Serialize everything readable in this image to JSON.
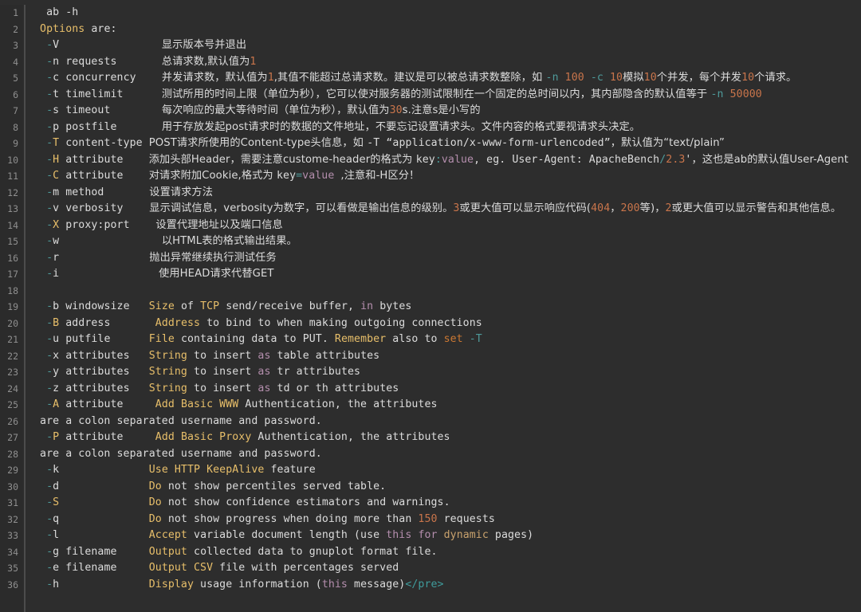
{
  "editor": {
    "language": "shell-help-output",
    "theme": "dark",
    "background_color": "#2d2d2d",
    "gutter_color": "#2b2b2b",
    "default_text_color": "#dcdcdc",
    "first_line_number": 1,
    "last_line_number": 36,
    "total_lines": 36
  },
  "palette": {
    "keyword_yellow": "#e8bf6a",
    "number_orange": "#c9754b",
    "purple": "#b48ead",
    "teal": "#4e9a9a",
    "salmon": "#cc7832",
    "tan": "#c9a26d",
    "line_number": "#8f8f8f"
  },
  "lines": [
    {
      "n": "1",
      "tokens": [
        {
          "t": "  ab -h",
          "c": "def"
        }
      ]
    },
    {
      "n": "2",
      "tokens": [
        {
          "t": " ",
          "c": "def"
        },
        {
          "t": "Options",
          "c": "key"
        },
        {
          "t": " are:",
          "c": "def"
        }
      ]
    },
    {
      "n": "3",
      "tokens": [
        {
          "t": "  ",
          "c": "def"
        },
        {
          "t": "-",
          "c": "teal"
        },
        {
          "t": "V                ",
          "c": "def"
        },
        {
          "t": "显示版本号并退出",
          "c": "cn"
        }
      ]
    },
    {
      "n": "4",
      "tokens": [
        {
          "t": "  ",
          "c": "def"
        },
        {
          "t": "-",
          "c": "teal"
        },
        {
          "t": "n requests       ",
          "c": "def"
        },
        {
          "t": "总请求数,默认值为",
          "c": "cn"
        },
        {
          "t": "1",
          "c": "num"
        }
      ]
    },
    {
      "n": "5",
      "tokens": [
        {
          "t": "  ",
          "c": "def"
        },
        {
          "t": "-",
          "c": "teal"
        },
        {
          "t": "c concurrency    ",
          "c": "def"
        },
        {
          "t": "并发请求数，默认值为",
          "c": "cn"
        },
        {
          "t": "1",
          "c": "num"
        },
        {
          "t": ",其值不能超过总请求数。建议是可以被总请求数整除，如 ",
          "c": "cn"
        },
        {
          "t": "-n",
          "c": "teal"
        },
        {
          "t": " ",
          "c": "def"
        },
        {
          "t": "100",
          "c": "num"
        },
        {
          "t": " ",
          "c": "def"
        },
        {
          "t": "-c",
          "c": "teal"
        },
        {
          "t": " ",
          "c": "def"
        },
        {
          "t": "10",
          "c": "num"
        },
        {
          "t": "模拟",
          "c": "cn"
        },
        {
          "t": "10",
          "c": "num"
        },
        {
          "t": "个并发，每个并发",
          "c": "cn"
        },
        {
          "t": "10",
          "c": "num"
        },
        {
          "t": "个请求。",
          "c": "cn"
        }
      ]
    },
    {
      "n": "6",
      "tokens": [
        {
          "t": "  ",
          "c": "def"
        },
        {
          "t": "-",
          "c": "teal"
        },
        {
          "t": "t timelimit      ",
          "c": "def"
        },
        {
          "t": "测试所用的时间上限（单位为秒），它可以使对服务器的测试限制在一个固定的总时间以内，其内部隐含的默认值等于 ",
          "c": "cn"
        },
        {
          "t": "-n",
          "c": "teal"
        },
        {
          "t": " ",
          "c": "def"
        },
        {
          "t": "50000",
          "c": "num"
        }
      ]
    },
    {
      "n": "7",
      "tokens": [
        {
          "t": "  ",
          "c": "def"
        },
        {
          "t": "-",
          "c": "teal"
        },
        {
          "t": "s timeout        ",
          "c": "def"
        },
        {
          "t": "每次响应的最大等待时间（单位为秒），默认值为",
          "c": "cn"
        },
        {
          "t": "30",
          "c": "num"
        },
        {
          "t": "s.注意s是小写的",
          "c": "cn"
        }
      ]
    },
    {
      "n": "8",
      "tokens": [
        {
          "t": "  ",
          "c": "def"
        },
        {
          "t": "-",
          "c": "teal"
        },
        {
          "t": "p postfile       ",
          "c": "def"
        },
        {
          "t": "用于存放发起post请求时的数据的文件地址，不要忘记设置请求头。文件内容的格式要视请求头决定。",
          "c": "cn"
        }
      ]
    },
    {
      "n": "9",
      "tokens": [
        {
          "t": "  ",
          "c": "def"
        },
        {
          "t": "-",
          "c": "teal"
        },
        {
          "t": "T",
          "c": "key"
        },
        {
          "t": " content-type ",
          "c": "def"
        },
        {
          "t": "POST请求所使用的Content-type头信息，如 ",
          "c": "cn"
        },
        {
          "t": "-T",
          "c": "def"
        },
        {
          "t": " “application/x-www-form-urlencoded”",
          "c": "def"
        },
        {
          "t": "，默认值为“text/plain”",
          "c": "cn"
        }
      ]
    },
    {
      "n": "10",
      "tokens": [
        {
          "t": "  ",
          "c": "def"
        },
        {
          "t": "-",
          "c": "teal"
        },
        {
          "t": "H",
          "c": "key"
        },
        {
          "t": " attribute    ",
          "c": "def"
        },
        {
          "t": "添加头部Header，需要注意custome-header的格式为 ",
          "c": "cn"
        },
        {
          "t": "key",
          "c": "def"
        },
        {
          "t": ":",
          "c": "teal"
        },
        {
          "t": "value",
          "c": "purple"
        },
        {
          "t": ", eg. User-Agent: ApacheBench",
          "c": "def"
        },
        {
          "t": "/",
          "c": "teal"
        },
        {
          "t": "2.3",
          "c": "num"
        },
        {
          "t": "'",
          "c": "def"
        },
        {
          "t": "，这也是ab的默认值User-Agent",
          "c": "cn"
        }
      ]
    },
    {
      "n": "11",
      "tokens": [
        {
          "t": "  ",
          "c": "def"
        },
        {
          "t": "-",
          "c": "teal"
        },
        {
          "t": "C",
          "c": "key"
        },
        {
          "t": " attribute    ",
          "c": "def"
        },
        {
          "t": "对请求附加Cookie,格式为 ",
          "c": "cn"
        },
        {
          "t": "key",
          "c": "def"
        },
        {
          "t": "=",
          "c": "teal"
        },
        {
          "t": "value",
          "c": "purple"
        },
        {
          "t": " ",
          "c": "def"
        },
        {
          "t": ",注意和-H区分！",
          "c": "cn"
        }
      ]
    },
    {
      "n": "12",
      "tokens": [
        {
          "t": "  ",
          "c": "def"
        },
        {
          "t": "-",
          "c": "teal"
        },
        {
          "t": "m method      ",
          "c": "def"
        },
        {
          "t": "  设置请求方法",
          "c": "cn"
        }
      ]
    },
    {
      "n": "13",
      "tokens": [
        {
          "t": "  ",
          "c": "def"
        },
        {
          "t": "-",
          "c": "teal"
        },
        {
          "t": "v verbosity   ",
          "c": "def"
        },
        {
          "t": "  显示调试信息，verbosity为数字，可以看做是输出信息的级别。",
          "c": "cn"
        },
        {
          "t": "3",
          "c": "num"
        },
        {
          "t": "或更大值可以显示响应代码(",
          "c": "cn"
        },
        {
          "t": "404",
          "c": "num"
        },
        {
          "t": "，",
          "c": "cn"
        },
        {
          "t": "200",
          "c": "num"
        },
        {
          "t": "等)，",
          "c": "cn"
        },
        {
          "t": "2",
          "c": "num"
        },
        {
          "t": "或更大值可以显示警告和其他信息。",
          "c": "cn"
        }
      ]
    },
    {
      "n": "14",
      "tokens": [
        {
          "t": "  ",
          "c": "def"
        },
        {
          "t": "-",
          "c": "teal"
        },
        {
          "t": "X",
          "c": "key"
        },
        {
          "t": " proxy:port   ",
          "c": "def"
        },
        {
          "t": "  设置代理地址以及端口信息",
          "c": "cn"
        }
      ]
    },
    {
      "n": "15",
      "tokens": [
        {
          "t": "  ",
          "c": "def"
        },
        {
          "t": "-",
          "c": "teal"
        },
        {
          "t": "w                ",
          "c": "def"
        },
        {
          "t": "以HTML表的格式输出结果。",
          "c": "cn"
        }
      ]
    },
    {
      "n": "16",
      "tokens": [
        {
          "t": "  ",
          "c": "def"
        },
        {
          "t": "-",
          "c": "teal"
        },
        {
          "t": "r             ",
          "c": "def"
        },
        {
          "t": "  抛出异常继续执行测试任务",
          "c": "cn"
        }
      ]
    },
    {
      "n": "17",
      "tokens": [
        {
          "t": "  ",
          "c": "def"
        },
        {
          "t": "-",
          "c": "teal"
        },
        {
          "t": "i               ",
          "c": "def"
        },
        {
          "t": " 使用HEAD请求代替GET",
          "c": "cn"
        }
      ]
    },
    {
      "n": "18",
      "tokens": [
        {
          "t": "",
          "c": "def"
        }
      ]
    },
    {
      "n": "19",
      "tokens": [
        {
          "t": "  ",
          "c": "def"
        },
        {
          "t": "-",
          "c": "teal"
        },
        {
          "t": "b windowsize   ",
          "c": "def"
        },
        {
          "t": "Size",
          "c": "key"
        },
        {
          "t": " of ",
          "c": "def"
        },
        {
          "t": "TCP",
          "c": "key"
        },
        {
          "t": " send/receive buffer, ",
          "c": "def"
        },
        {
          "t": "in",
          "c": "purple"
        },
        {
          "t": " bytes",
          "c": "def"
        }
      ]
    },
    {
      "n": "20",
      "tokens": [
        {
          "t": "  ",
          "c": "def"
        },
        {
          "t": "-",
          "c": "teal"
        },
        {
          "t": "B",
          "c": "key"
        },
        {
          "t": " address       ",
          "c": "def"
        },
        {
          "t": "Address",
          "c": "key"
        },
        {
          "t": " to bind to when making outgoing connections",
          "c": "def"
        }
      ]
    },
    {
      "n": "21",
      "tokens": [
        {
          "t": "  ",
          "c": "def"
        },
        {
          "t": "-",
          "c": "teal"
        },
        {
          "t": "u putfile      ",
          "c": "def"
        },
        {
          "t": "File",
          "c": "key"
        },
        {
          "t": " containing data to PUT. ",
          "c": "def"
        },
        {
          "t": "Remember",
          "c": "key"
        },
        {
          "t": " also to ",
          "c": "def"
        },
        {
          "t": "set",
          "c": "salmon"
        },
        {
          "t": " ",
          "c": "def"
        },
        {
          "t": "-T",
          "c": "teal"
        }
      ]
    },
    {
      "n": "22",
      "tokens": [
        {
          "t": "  ",
          "c": "def"
        },
        {
          "t": "-",
          "c": "teal"
        },
        {
          "t": "x attributes   ",
          "c": "def"
        },
        {
          "t": "String",
          "c": "key"
        },
        {
          "t": " to insert ",
          "c": "def"
        },
        {
          "t": "as",
          "c": "purple"
        },
        {
          "t": " table attributes",
          "c": "def"
        }
      ]
    },
    {
      "n": "23",
      "tokens": [
        {
          "t": "  ",
          "c": "def"
        },
        {
          "t": "-",
          "c": "teal"
        },
        {
          "t": "y attributes   ",
          "c": "def"
        },
        {
          "t": "String",
          "c": "key"
        },
        {
          "t": " to insert ",
          "c": "def"
        },
        {
          "t": "as",
          "c": "purple"
        },
        {
          "t": " tr attributes",
          "c": "def"
        }
      ]
    },
    {
      "n": "24",
      "tokens": [
        {
          "t": "  ",
          "c": "def"
        },
        {
          "t": "-",
          "c": "teal"
        },
        {
          "t": "z attributes   ",
          "c": "def"
        },
        {
          "t": "String",
          "c": "key"
        },
        {
          "t": " to insert ",
          "c": "def"
        },
        {
          "t": "as",
          "c": "purple"
        },
        {
          "t": " td or th attributes",
          "c": "def"
        }
      ]
    },
    {
      "n": "25",
      "tokens": [
        {
          "t": "  ",
          "c": "def"
        },
        {
          "t": "-",
          "c": "teal"
        },
        {
          "t": "A",
          "c": "key"
        },
        {
          "t": " attribute     ",
          "c": "def"
        },
        {
          "t": "Add Basic WWW",
          "c": "key"
        },
        {
          "t": " Authentication, the attributes",
          "c": "def"
        }
      ]
    },
    {
      "n": "26",
      "tokens": [
        {
          "t": " are a colon separated username and password.",
          "c": "def"
        }
      ]
    },
    {
      "n": "27",
      "tokens": [
        {
          "t": "  ",
          "c": "def"
        },
        {
          "t": "-",
          "c": "teal"
        },
        {
          "t": "P",
          "c": "key"
        },
        {
          "t": " attribute     ",
          "c": "def"
        },
        {
          "t": "Add Basic Proxy",
          "c": "key"
        },
        {
          "t": " Authentication, the attributes",
          "c": "def"
        }
      ]
    },
    {
      "n": "28",
      "tokens": [
        {
          "t": " are a colon separated username and password.",
          "c": "def"
        }
      ]
    },
    {
      "n": "29",
      "tokens": [
        {
          "t": "  ",
          "c": "def"
        },
        {
          "t": "-",
          "c": "teal"
        },
        {
          "t": "k              ",
          "c": "def"
        },
        {
          "t": "Use HTTP KeepAlive",
          "c": "key"
        },
        {
          "t": " feature",
          "c": "def"
        }
      ]
    },
    {
      "n": "30",
      "tokens": [
        {
          "t": "  ",
          "c": "def"
        },
        {
          "t": "-",
          "c": "teal"
        },
        {
          "t": "d              ",
          "c": "def"
        },
        {
          "t": "Do",
          "c": "key"
        },
        {
          "t": " not show percentiles served table.",
          "c": "def"
        }
      ]
    },
    {
      "n": "31",
      "tokens": [
        {
          "t": "  ",
          "c": "def"
        },
        {
          "t": "-",
          "c": "teal"
        },
        {
          "t": "S",
          "c": "key"
        },
        {
          "t": "              ",
          "c": "def"
        },
        {
          "t": "Do",
          "c": "key"
        },
        {
          "t": " not show confidence estimators and warnings.",
          "c": "def"
        }
      ]
    },
    {
      "n": "32",
      "tokens": [
        {
          "t": "  ",
          "c": "def"
        },
        {
          "t": "-",
          "c": "teal"
        },
        {
          "t": "q              ",
          "c": "def"
        },
        {
          "t": "Do",
          "c": "key"
        },
        {
          "t": " not show progress when doing more than ",
          "c": "def"
        },
        {
          "t": "150",
          "c": "num"
        },
        {
          "t": " requests",
          "c": "def"
        }
      ]
    },
    {
      "n": "33",
      "tokens": [
        {
          "t": "  ",
          "c": "def"
        },
        {
          "t": "-",
          "c": "teal"
        },
        {
          "t": "l              ",
          "c": "def"
        },
        {
          "t": "Accept",
          "c": "key"
        },
        {
          "t": " variable document length (use ",
          "c": "def"
        },
        {
          "t": "this",
          "c": "purple"
        },
        {
          "t": " ",
          "c": "def"
        },
        {
          "t": "for",
          "c": "purple"
        },
        {
          "t": " ",
          "c": "def"
        },
        {
          "t": "dynamic",
          "c": "tan"
        },
        {
          "t": " pages)",
          "c": "def"
        }
      ]
    },
    {
      "n": "34",
      "tokens": [
        {
          "t": "  ",
          "c": "def"
        },
        {
          "t": "-",
          "c": "teal"
        },
        {
          "t": "g filename     ",
          "c": "def"
        },
        {
          "t": "Output",
          "c": "key"
        },
        {
          "t": " collected data to gnuplot format file.",
          "c": "def"
        }
      ]
    },
    {
      "n": "35",
      "tokens": [
        {
          "t": "  ",
          "c": "def"
        },
        {
          "t": "-",
          "c": "teal"
        },
        {
          "t": "e filename     ",
          "c": "def"
        },
        {
          "t": "Output CSV",
          "c": "key"
        },
        {
          "t": " file with percentages served",
          "c": "def"
        }
      ]
    },
    {
      "n": "36",
      "tokens": [
        {
          "t": "  ",
          "c": "def"
        },
        {
          "t": "-",
          "c": "teal"
        },
        {
          "t": "h              ",
          "c": "def"
        },
        {
          "t": "Display",
          "c": "key"
        },
        {
          "t": " usage information (",
          "c": "def"
        },
        {
          "t": "this",
          "c": "purple"
        },
        {
          "t": " message)",
          "c": "def"
        },
        {
          "t": "</pre>",
          "c": "tag"
        }
      ]
    }
  ]
}
